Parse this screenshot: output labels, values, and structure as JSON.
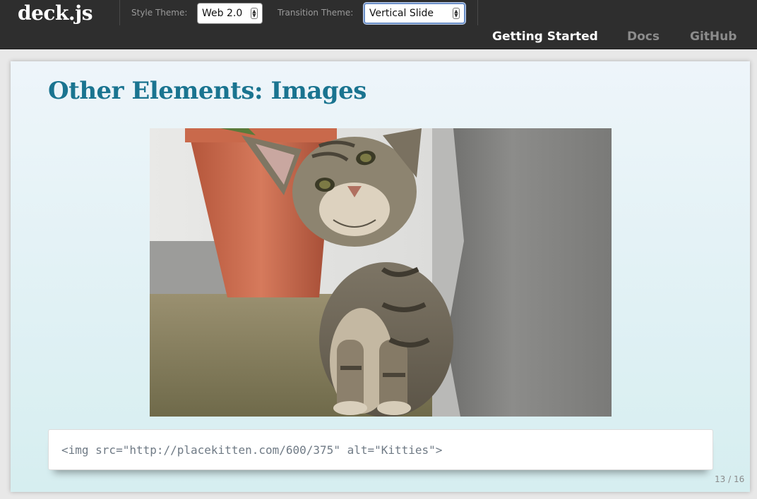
{
  "header": {
    "logo": "deck.js",
    "style_theme_label": "Style Theme:",
    "style_theme_value": "Web 2.0",
    "transition_theme_label": "Transition Theme:",
    "transition_theme_value": "Vertical Slide",
    "nav": [
      {
        "label": "Getting Started",
        "active": true
      },
      {
        "label": "Docs",
        "active": false
      },
      {
        "label": "GitHub",
        "active": false
      }
    ]
  },
  "slide": {
    "title": "Other Elements: Images",
    "image_alt": "Kitties",
    "code": "<img src=\"http://placekitten.com/600/375\" alt=\"Kitties\">",
    "counter": "13 / 16"
  },
  "colors": {
    "topbar": "#2e2e2e",
    "title": "#1a7490",
    "focus_ring": "#6b8fc7"
  },
  "icons": [
    "select-spinner-icon"
  ]
}
